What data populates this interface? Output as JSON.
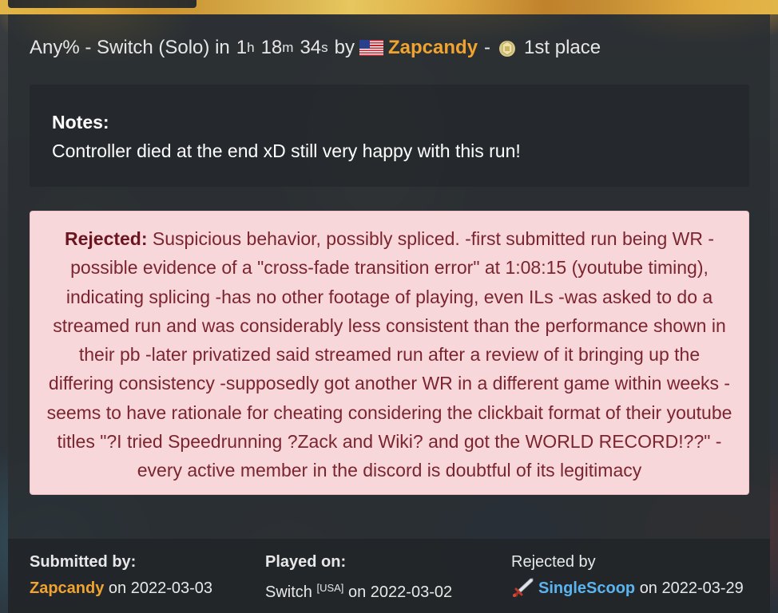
{
  "run": {
    "category": "Any% - Switch (Solo) in",
    "time_h": "1",
    "time_h_unit": "h",
    "time_m": "18",
    "time_m_unit": "m",
    "time_s": "34",
    "time_s_unit": "s",
    "by": "by",
    "player": "Zapcandy",
    "separator": "-",
    "place": "1st place",
    "flag_icon": "usa-flag-icon",
    "place_icon": "first-place-trophy-icon"
  },
  "notes": {
    "label": "Notes:",
    "text": "Controller died at the end xD still very happy with this run!"
  },
  "rejection": {
    "label": "Rejected:",
    "reason": "Suspicious behavior, possibly spliced. -first submitted run being WR -possible evidence of a \"cross-fade transition error\" at 1:08:15 (youtube timing), indicating splicing -has no other footage of playing, even ILs -was asked to do a streamed run and was considerably less consistent than the performance shown in their pb -later privatized said streamed run after a review of it bringing up the differing consistency -supposedly got another WR in a different game within weeks -seems to have rationale for cheating considering the clickbait format of their youtube titles \"?I tried Speedrunning ?Zack and Wiki? and got the WORLD RECORD!??\" -every active member in the discord is doubtful of its legitimacy",
    "colors": {
      "background": "#f8d7da",
      "text": "#7a2530"
    }
  },
  "footer": {
    "submitted_label": "Submitted by:",
    "submitted_user": "Zapcandy",
    "submitted_on": "on 2022-03-03",
    "played_label": "Played on:",
    "played_platform": "Switch",
    "played_region": "[USA]",
    "played_on": "on 2022-03-02",
    "rejected_label": "Rejected by",
    "rejected_user": "SingleScoop",
    "rejected_on": "on 2022-03-29",
    "moderator_icon": "sword-moderator-icon"
  },
  "colors": {
    "player_orange": "#f0a32e",
    "moderator_blue": "#5ab4f0"
  }
}
